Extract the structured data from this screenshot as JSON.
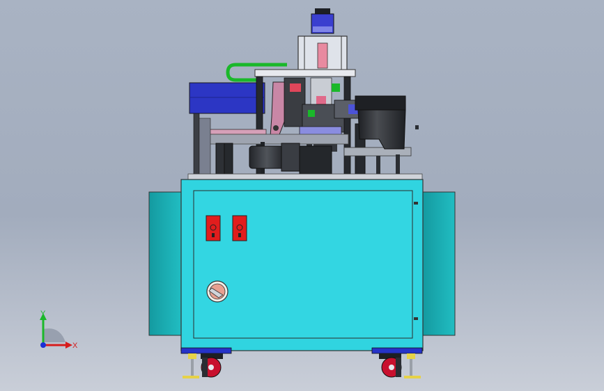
{
  "colors": {
    "background_top": "#a9b3c3",
    "background_bottom": "#c9ced8",
    "cabinet_face": "#30d4e0",
    "cabinet_side": "#1fb5b7",
    "switch_red": "#e11d1d",
    "frame_blue": "#2633c8",
    "wheel_red": "#c8102e",
    "dark_metal": "#2a2d33",
    "hopper_grey": "#3c3f44",
    "triad_x": "#d61c1c",
    "triad_y": "#1bb82a",
    "triad_z": "#1a2fd6"
  },
  "scene": {
    "icons": [
      "machine-model",
      "control-cabinet",
      "red-switch",
      "rotary-knob",
      "caster-wheel",
      "leveling-foot",
      "vibratory-bowl-feeder",
      "motor",
      "cylinder"
    ],
    "axis_triad": {
      "x_label": "X",
      "y_label": "Y"
    }
  }
}
